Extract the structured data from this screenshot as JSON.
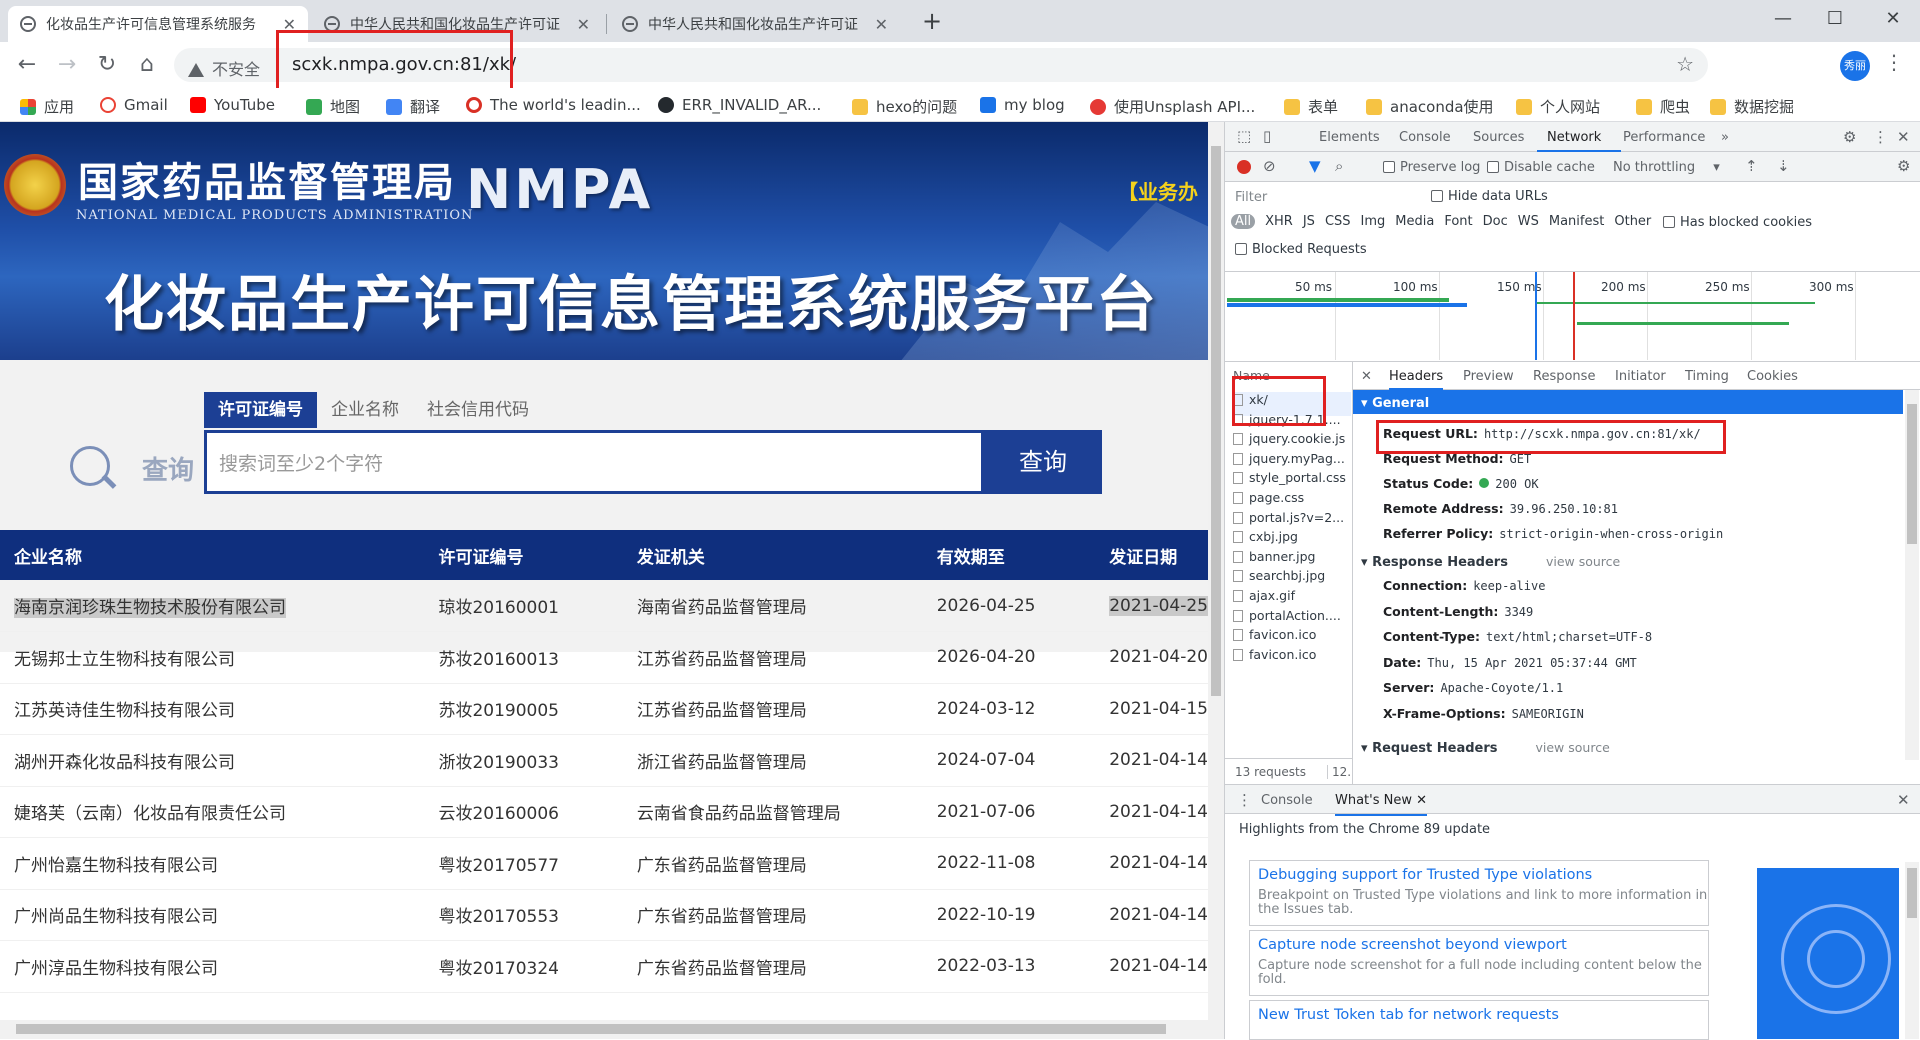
{
  "browser": {
    "tabs": [
      {
        "title": "化妆品生产许可信息管理系统服务",
        "active": true
      },
      {
        "title": "中华人民共和国化妆品生产许可证",
        "active": false
      },
      {
        "title": "中华人民共和国化妆品生产许可证",
        "active": false
      }
    ],
    "omnibox": {
      "security_label": "不安全",
      "url": "scxk.nmpa.gov.cn:81/xk/"
    },
    "profile_label": "秀丽",
    "bookmarks": [
      {
        "label": "应用",
        "icon": "apps-grid-icon"
      },
      {
        "label": "Gmail",
        "icon": "google-icon"
      },
      {
        "label": "YouTube",
        "icon": "youtube-icon"
      },
      {
        "label": "地图",
        "icon": "maps-icon"
      },
      {
        "label": "翻译",
        "icon": "translate-icon"
      },
      {
        "label": "The world's leadin...",
        "icon": "site-icon"
      },
      {
        "label": "ERR_INVALID_AR...",
        "icon": "github-icon"
      },
      {
        "label": "hexo的问题",
        "icon": "folder-icon"
      },
      {
        "label": "my blog",
        "icon": "site-icon"
      },
      {
        "label": "使用Unsplash API...",
        "icon": "site-icon"
      },
      {
        "label": "表单",
        "icon": "folder-icon"
      },
      {
        "label": "anaconda使用",
        "icon": "folder-icon"
      },
      {
        "label": "个人网站",
        "icon": "folder-icon"
      },
      {
        "label": "爬虫",
        "icon": "folder-icon"
      },
      {
        "label": "数据挖掘",
        "icon": "folder-icon"
      }
    ]
  },
  "page": {
    "agency_cn": "国家药品监督管理局",
    "agency_en": "NATIONAL MEDICAL PRODUCTS ADMINISTRATION",
    "nmpa_logo": "NMPA",
    "business_link": "【业务办",
    "platform_title": "化妆品生产许可信息管理系统服务平台",
    "search_tabs": [
      "许可证编号",
      "企业名称",
      "社会信用代码"
    ],
    "search_logo_label": "查询",
    "search_placeholder": "搜索词至少2个字符",
    "search_button": "查询",
    "table": {
      "headers": [
        "企业名称",
        "许可证编号",
        "发证机关",
        "有效期至",
        "发证日期"
      ],
      "rows": [
        [
          "海南京润珍珠生物技术股份有限公司",
          "琼妆20160001",
          "海南省药品监督管理局",
          "2026-04-25",
          "2021-04-25"
        ],
        [
          "无锡邦士立生物科技有限公司",
          "苏妆20160013",
          "江苏省药品监督管理局",
          "2026-04-20",
          "2021-04-20"
        ],
        [
          "江苏英诗佳生物科技有限公司",
          "苏妆20190005",
          "江苏省药品监督管理局",
          "2024-03-12",
          "2021-04-15"
        ],
        [
          "湖州开森化妆品科技有限公司",
          "浙妆20190033",
          "浙江省药品监督管理局",
          "2024-07-04",
          "2021-04-14"
        ],
        [
          "婕珞芙（云南）化妆品有限责任公司",
          "云妆20160006",
          "云南省食品药品监督管理局",
          "2021-07-06",
          "2021-04-14"
        ],
        [
          "广州怡嘉生物科技有限公司",
          "粤妆20170577",
          "广东省药品监督管理局",
          "2022-11-08",
          "2021-04-14"
        ],
        [
          "广州尚品生物科技有限公司",
          "粤妆20170553",
          "广东省药品监督管理局",
          "2022-10-19",
          "2021-04-14"
        ],
        [
          "广州淳品生物科技有限公司",
          "粤妆20170324",
          "广东省药品监督管理局",
          "2022-03-13",
          "2021-04-14"
        ]
      ]
    }
  },
  "devtools": {
    "tabs": [
      "Elements",
      "Console",
      "Sources",
      "Network",
      "Performance"
    ],
    "active_tab": "Network",
    "toolbar": {
      "preserve_log": "Preserve log",
      "disable_cache": "Disable cache",
      "throttling": "No throttling"
    },
    "filter_placeholder": "Filter",
    "hide_data_urls": "Hide data URLs",
    "type_filters": [
      "All",
      "XHR",
      "JS",
      "CSS",
      "Img",
      "Media",
      "Font",
      "Doc",
      "WS",
      "Manifest",
      "Other"
    ],
    "has_blocked_cookies": "Has blocked cookies",
    "blocked_requests": "Blocked Requests",
    "timeline_ticks": [
      "50 ms",
      "100 ms",
      "150 ms",
      "200 ms",
      "250 ms",
      "300 ms"
    ],
    "name_header": "Name",
    "requests": [
      "xk/",
      "jquery-1.7.1....",
      "jquery.cookie.js",
      "jquery.myPag...",
      "style_portal.css",
      "page.css",
      "portal.js?v=2...",
      "cxbj.jpg",
      "banner.jpg",
      "searchbj.jpg",
      "ajax.gif",
      "portalAction....",
      "favicon.ico",
      "favicon.ico"
    ],
    "request_count": "13 requests",
    "request_size_trunc": "12.",
    "detail_tabs": [
      "Headers",
      "Preview",
      "Response",
      "Initiator",
      "Timing",
      "Cookies"
    ],
    "general": {
      "title": "General",
      "request_url_k": "Request URL:",
      "request_url_v": "http://scxk.nmpa.gov.cn:81/xk/",
      "method_k": "Request Method:",
      "method_v": "GET",
      "status_k": "Status Code:",
      "status_v": "200 OK",
      "remote_k": "Remote Address:",
      "remote_v": "39.96.250.10:81",
      "referrer_k": "Referrer Policy:",
      "referrer_v": "strict-origin-when-cross-origin"
    },
    "response_headers": {
      "title": "Response Headers",
      "view_source": "view source",
      "items": [
        {
          "k": "Connection:",
          "v": "keep-alive"
        },
        {
          "k": "Content-Length:",
          "v": "3349"
        },
        {
          "k": "Content-Type:",
          "v": "text/html;charset=UTF-8"
        },
        {
          "k": "Date:",
          "v": "Thu, 15 Apr 2021 05:37:44 GMT"
        },
        {
          "k": "Server:",
          "v": "Apache-Coyote/1.1"
        },
        {
          "k": "X-Frame-Options:",
          "v": "SAMEORIGIN"
        }
      ]
    },
    "request_headers": {
      "title": "Request Headers",
      "view_source": "view source"
    },
    "drawer": {
      "tabs": [
        "Console",
        "What's New"
      ],
      "highlights": "Highlights from the Chrome 89 update",
      "cards": [
        {
          "title": "Debugging support for Trusted Type violations",
          "desc": "Breakpoint on Trusted Type violations and link to more information in the Issues tab."
        },
        {
          "title": "Capture node screenshot beyond viewport",
          "desc": "Capture node screenshot for a full node including content below the fold."
        },
        {
          "title": "New Trust Token tab for network requests",
          "desc": ""
        }
      ]
    }
  },
  "colors": {
    "accent": "#1a73e8",
    "table_header": "#0f2f7e",
    "highlight_red": "#e02020"
  }
}
